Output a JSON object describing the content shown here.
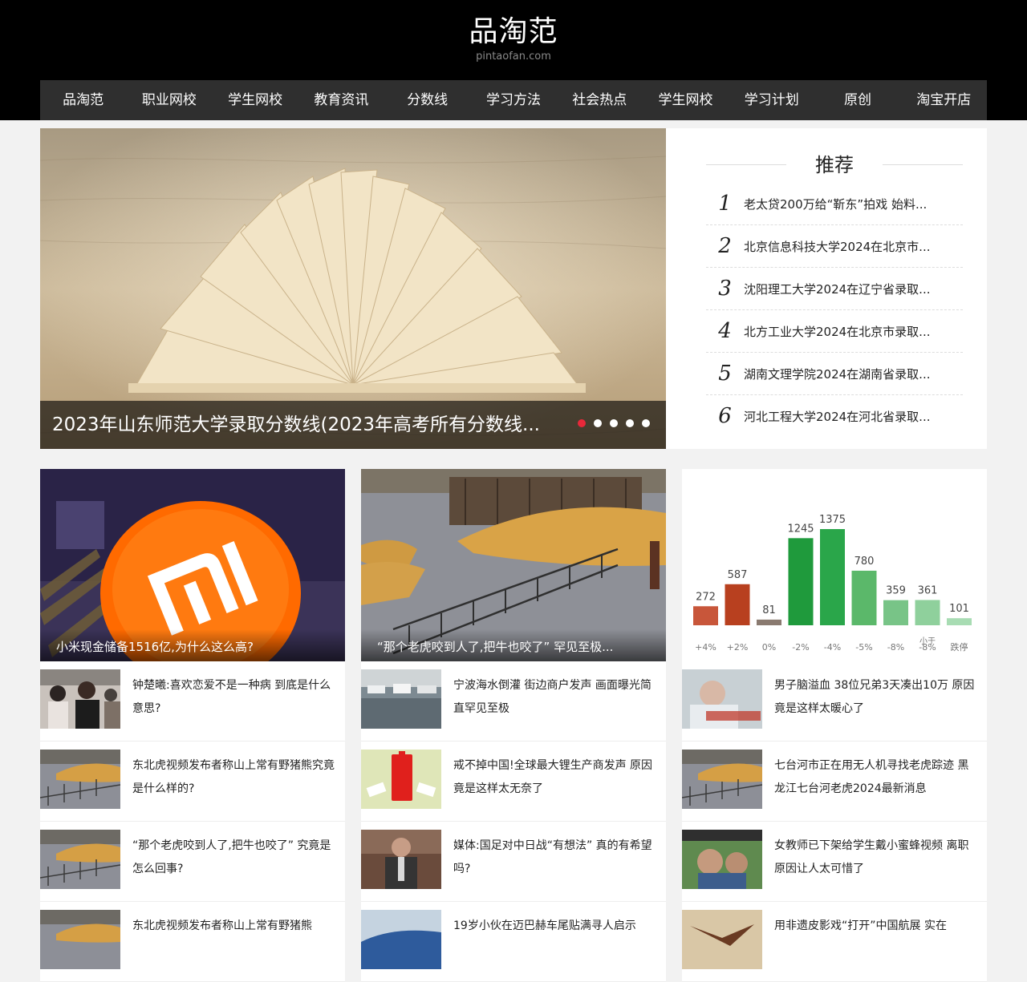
{
  "site": {
    "name": "品淘范",
    "domain": "pintaofan.com"
  },
  "nav": [
    "品淘范",
    "职业网校",
    "学生网校",
    "教育资讯",
    "分数线",
    "学习方法",
    "社会热点",
    "学生网校",
    "学习计划",
    "原创",
    "淘宝开店"
  ],
  "hero": {
    "title": "2023年山东师范大学录取分数线(2023年高考所有分数线...",
    "slide_count": 5,
    "active_slide": 1
  },
  "recommend": {
    "title": "推荐",
    "items": [
      {
        "rank": "1",
        "text": "老太贷200万给“靳东”拍戏 始料..."
      },
      {
        "rank": "2",
        "text": "北京信息科技大学2024在北京市..."
      },
      {
        "rank": "3",
        "text": "沈阳理工大学2024在辽宁省录取..."
      },
      {
        "rank": "4",
        "text": "北方工业大学2024在北京市录取..."
      },
      {
        "rank": "5",
        "text": "湖南文理学院2024在湖南省录取..."
      },
      {
        "rank": "6",
        "text": "河北工程大学2024在河北省录取..."
      }
    ]
  },
  "columns": [
    {
      "feature": "小米现金储备1516亿,为什么这么高?",
      "items": [
        "钟楚曦:喜欢恋爱不是一种病 到底是什么意思?",
        "东北虎视频发布者称山上常有野猪熊究竟是什么样的?",
        "“那个老虎咬到人了,把牛也咬了” 究竟是怎么回事?",
        "东北虎视频发布者称山上常有野猪熊"
      ]
    },
    {
      "feature": "“那个老虎咬到人了,把牛也咬了” 罕见至极...",
      "items": [
        "宁波海水倒灌 街边商户发声 画面曝光简直罕见至极",
        "戒不掉中国!全球最大锂生产商发声 原因竟是这样太无奈了",
        "媒体:国足对中日战“有想法” 真的有希望吗?",
        "19岁小伙在迈巴赫车尾贴满寻人启示"
      ]
    },
    {
      "feature": "",
      "chart_values": [
        "272",
        "587",
        "81",
        "1245",
        "1375",
        "780",
        "359",
        "361",
        "101"
      ],
      "chart_pct": [
        "+4%",
        "+2%",
        "0%",
        "-2%",
        "-4%",
        "-5%",
        "-8%",
        "-8%",
        "跌停"
      ],
      "chart_extra_label": "小于",
      "items": [
        "男子脑溢血 38位兄弟3天凑出10万 原因竟是这样太暖心了",
        "七台河市正在用无人机寻找老虎踪迹 黑龙江七台河老虎2024最新消息",
        "女教师已下架给学生戴小蜜蜂视频 离职原因让人太可惜了",
        "用非遗皮影戏“打开”中国航展 实在"
      ]
    }
  ]
}
